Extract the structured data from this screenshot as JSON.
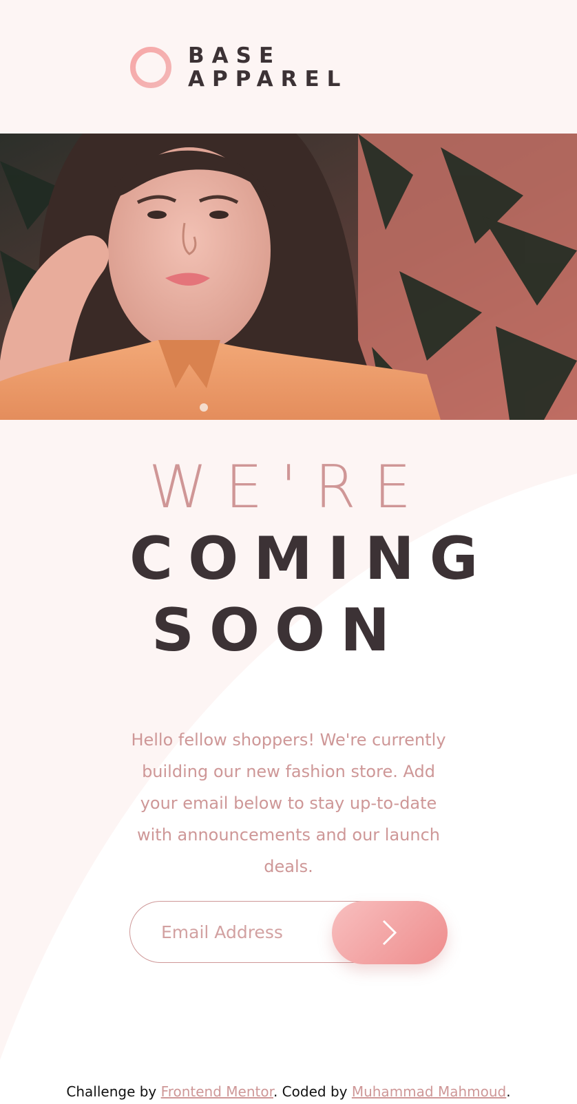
{
  "brand": {
    "line1": "BASE",
    "line2": "APPAREL"
  },
  "headline": {
    "line1": "WE'RE",
    "line2": "COMING",
    "line3": "SOON"
  },
  "intro_text": "Hello fellow shoppers! We're currently building our new fashion store. Add your email below to stay up-to-date with announcements and our launch deals.",
  "signup": {
    "email_placeholder": "Email Address",
    "email_value": ""
  },
  "footer": {
    "prefix": "Challenge by ",
    "mentor_link": "Frontend Mentor",
    "middle": ". Coded by ",
    "author_link": "Muhammad Mahmoud",
    "suffix": "."
  },
  "icons": {
    "logo": "ring-logo-icon",
    "submit": "chevron-right-icon"
  },
  "colors": {
    "background": "#fdf5f4",
    "accent": "#ce9797",
    "dark": "#3c3235",
    "gradient_start": "#f8bfbf",
    "gradient_end": "#ee8c8c"
  }
}
